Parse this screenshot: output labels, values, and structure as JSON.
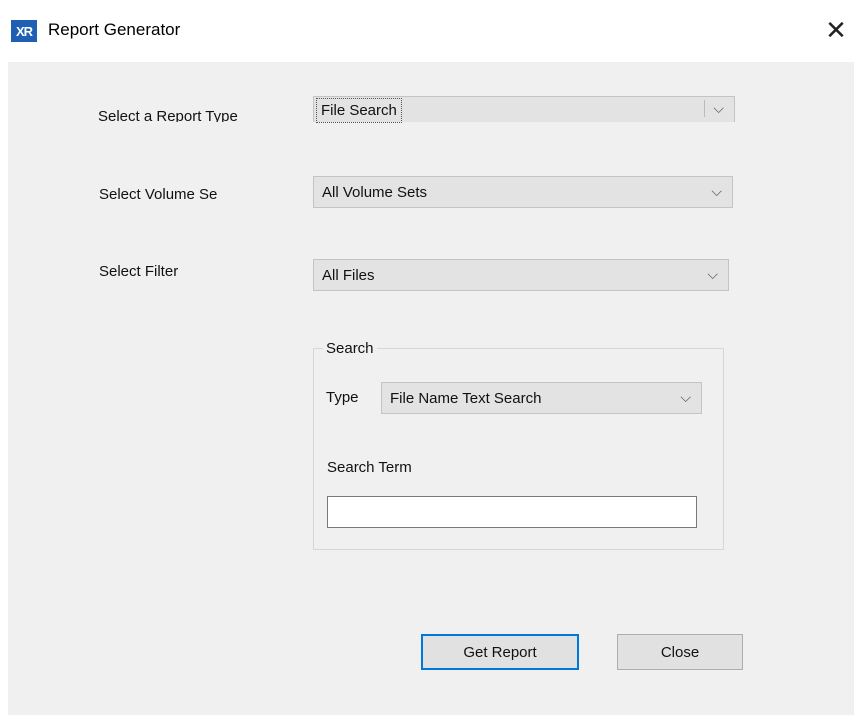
{
  "window": {
    "icon_text": "XR",
    "title": "Report Generator",
    "close_glyph": "✕"
  },
  "form": {
    "report_type": {
      "label": "Select a Report Type",
      "value": "File Search"
    },
    "volume_set": {
      "label": "Select Volume Se",
      "value": "All Volume Sets"
    },
    "filter": {
      "label": "Select Filter",
      "value": "All Files"
    },
    "chevron": "⌵"
  },
  "search": {
    "group_title": "Search",
    "type_label": "Type",
    "type_value": "File Name Text Search",
    "term_label": "Search Term",
    "term_value": ""
  },
  "buttons": {
    "get_report": "Get Report",
    "close": "Close"
  },
  "colors": {
    "accent": "#0078d7",
    "app_icon": "#1f5fb4",
    "client_bg": "#f0f0f0"
  }
}
